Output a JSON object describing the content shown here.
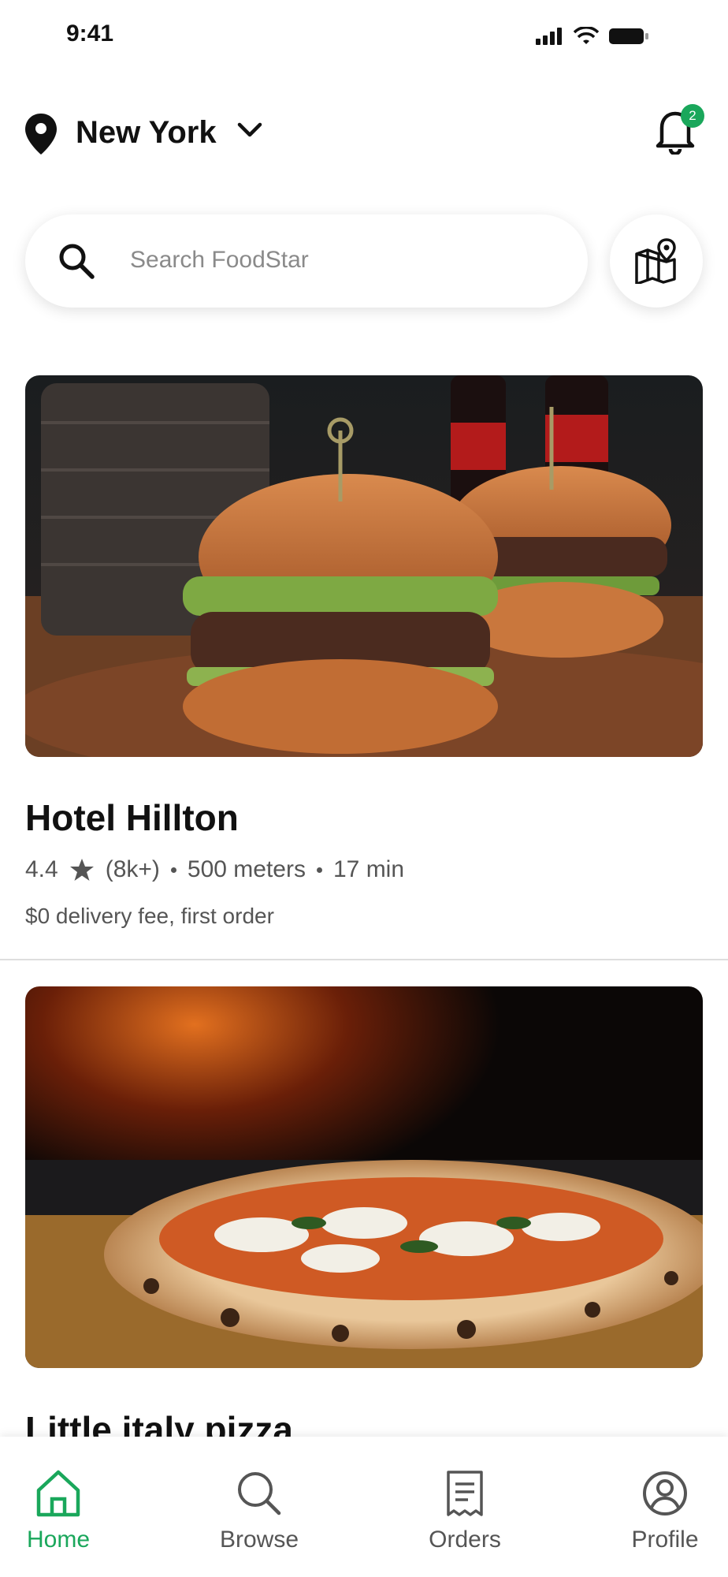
{
  "status_bar": {
    "time": "9:41"
  },
  "header": {
    "city": "New York",
    "notification_count": "2"
  },
  "search": {
    "placeholder": "Search FoodStar"
  },
  "restaurants": [
    {
      "name": "Hotel Hillton",
      "rating": "4.4",
      "reviews": "(8k+)",
      "distance": "500 meters",
      "time": "17 min",
      "promo": "$0 delivery fee, first order"
    },
    {
      "name": "Little italy pizza"
    }
  ],
  "tabs": [
    {
      "label": "Home",
      "icon": "home-icon",
      "active": true
    },
    {
      "label": "Browse",
      "icon": "search-icon",
      "active": false
    },
    {
      "label": "Orders",
      "icon": "receipt-icon",
      "active": false
    },
    {
      "label": "Profile",
      "icon": "profile-icon",
      "active": false
    }
  ],
  "colors": {
    "accent": "#1aa75b",
    "text": "#111111",
    "muted": "#555555"
  }
}
